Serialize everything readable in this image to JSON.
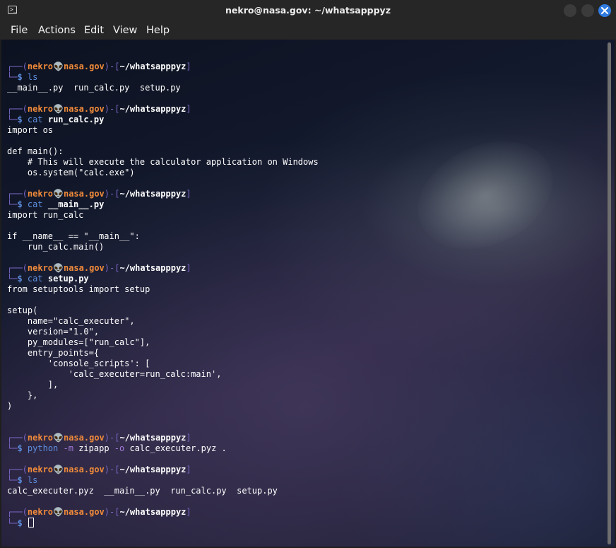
{
  "window": {
    "title": "nekro@nasa.gov: ~/whatsapppyz",
    "app_icon_glyph": ">_"
  },
  "menu": [
    "File",
    "Actions",
    "Edit",
    "View",
    "Help"
  ],
  "prompt": {
    "user": "nekro",
    "skull": "👽",
    "host": "nasa.gov",
    "path": "~/whatsapppyz",
    "dollar": "$"
  },
  "colors": {
    "accent_blue": "#5e8fe0",
    "user_orange": "#f08a3a",
    "bracket_purple": "#7d68c9",
    "close_button": "#2f7be0"
  },
  "commands": [
    {
      "cmd": "ls",
      "args": ""
    },
    {
      "cmd": "cat",
      "args": "run_calc.py"
    },
    {
      "cmd": "cat",
      "args": "__main__.py"
    },
    {
      "cmd": "cat",
      "args": "setup.py"
    },
    {
      "cmd": "python",
      "flag1": "-m",
      "arg1": "zipapp",
      "flag2": "-o",
      "arg2": "calc_executer.pyz ."
    },
    {
      "cmd": "ls",
      "args": ""
    }
  ],
  "outputs": {
    "ls1": [
      "__main__.py  run_calc.py  setup.py"
    ],
    "run_calc": [
      "import os",
      "",
      "def main():",
      "    # This will execute the calculator application on Windows",
      "    os.system(\"calc.exe\")",
      ""
    ],
    "main": [
      "import run_calc",
      "",
      "if __name__ == \"__main__\":",
      "    run_calc.main()",
      ""
    ],
    "setup": [
      "from setuptools import setup",
      "",
      "setup(",
      "    name=\"calc_executer\",",
      "    version=\"1.0\",",
      "    py_modules=[\"run_calc\"],",
      "    entry_points={",
      "        'console_scripts': [",
      "            'calc_executer=run_calc:main',",
      "        ],",
      "    },",
      ")",
      "",
      ""
    ],
    "zipapp": [
      ""
    ],
    "ls2": [
      "calc_executer.pyz  __main__.py  run_calc.py  setup.py",
      ""
    ]
  }
}
